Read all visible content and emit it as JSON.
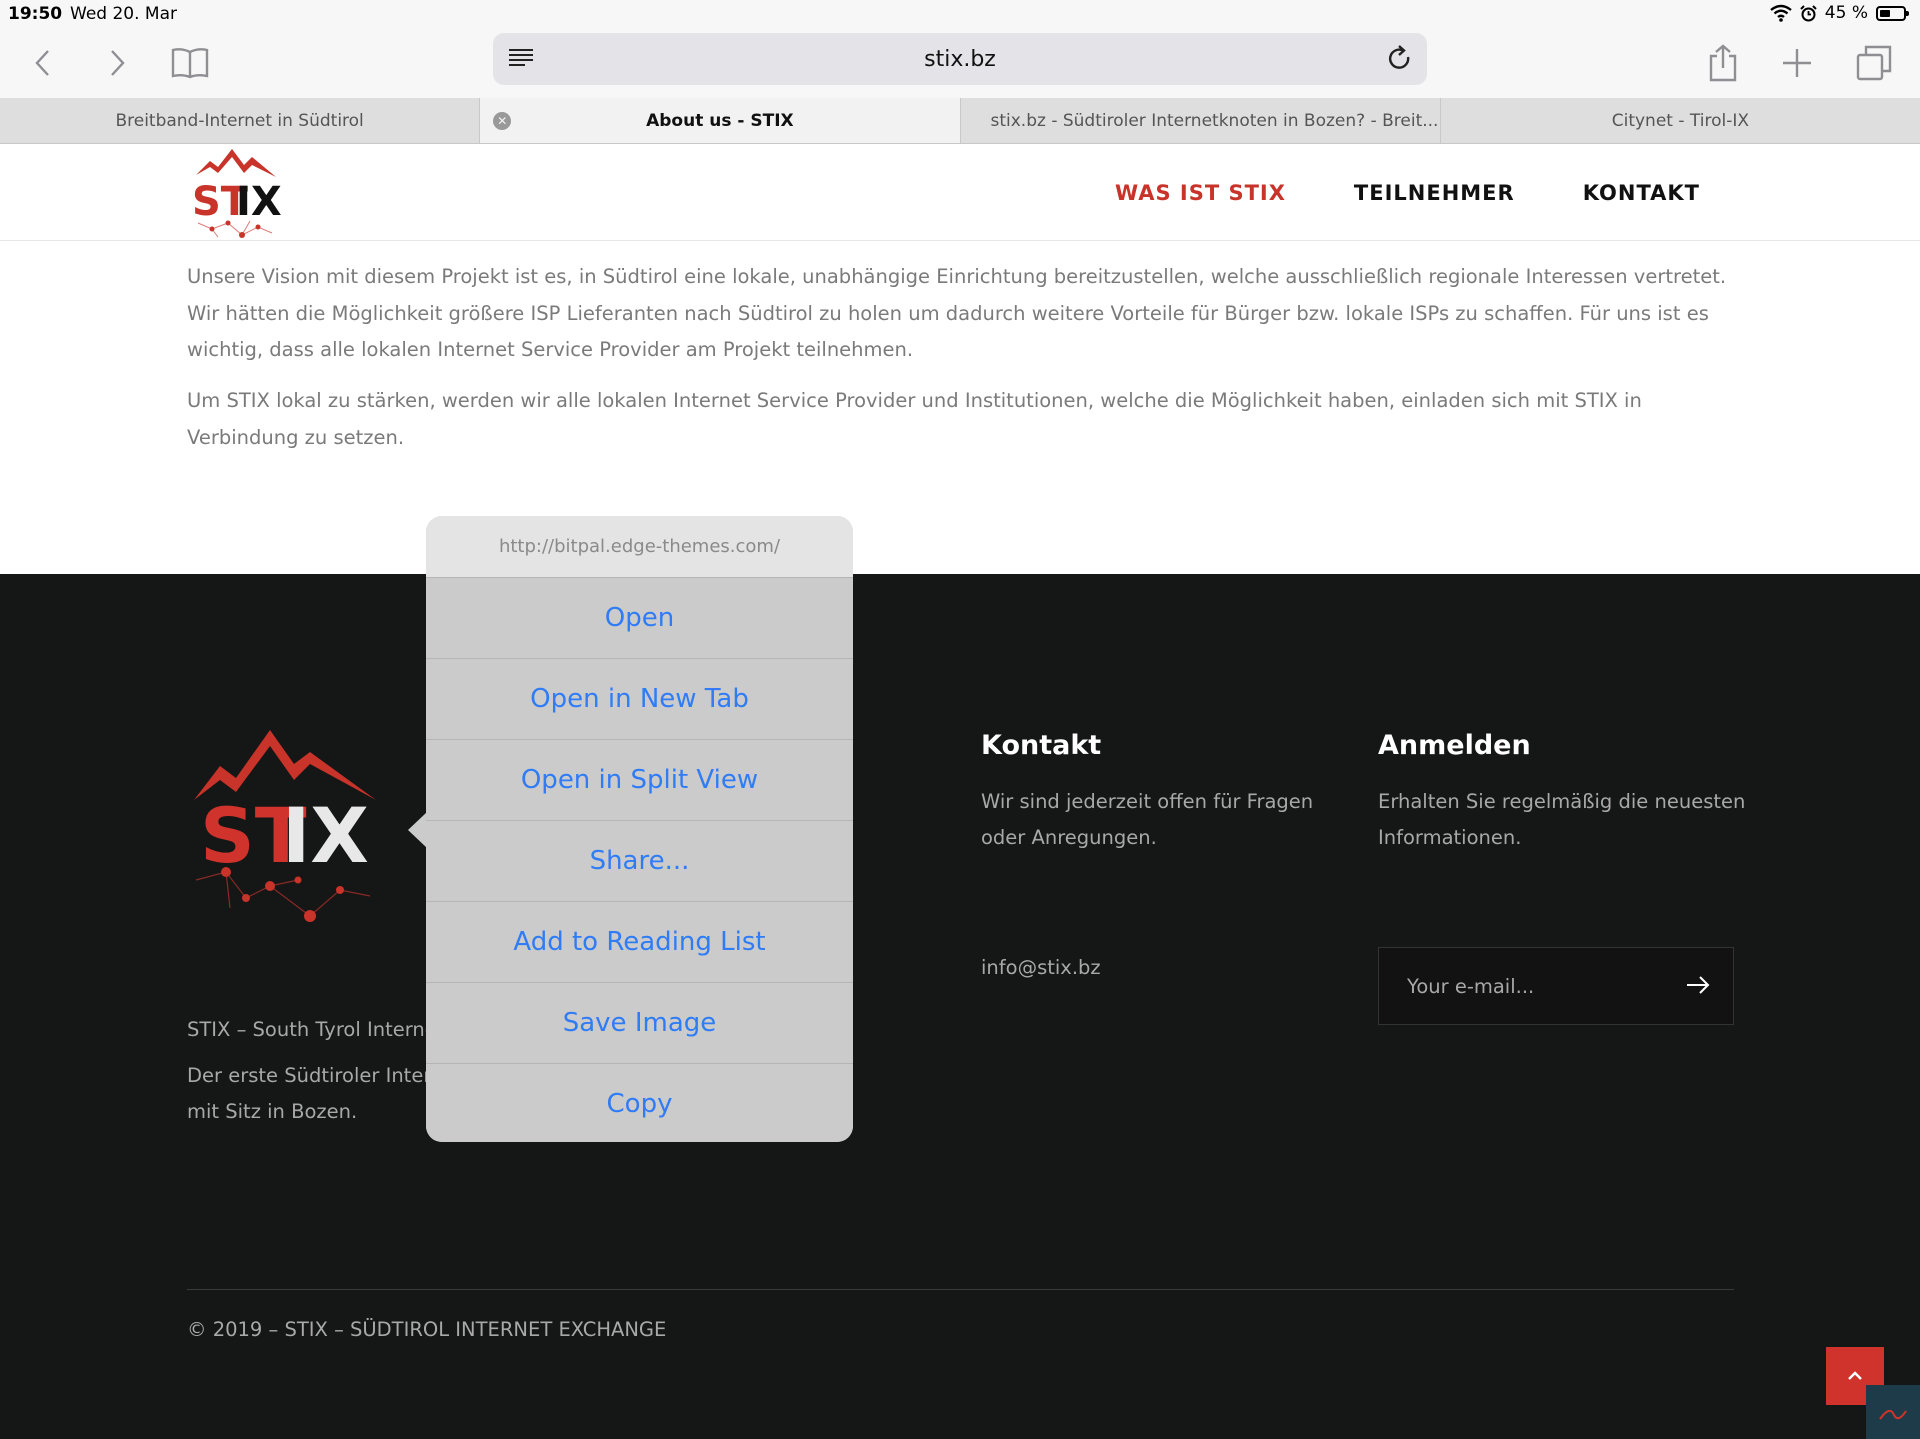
{
  "status_bar": {
    "time": "19:50",
    "date": "Wed 20. Mar",
    "battery": "45 %"
  },
  "toolbar": {
    "host": "stix.bz"
  },
  "tabs": [
    {
      "label": "Breitband-Internet in Südtirol"
    },
    {
      "label": "About us - STIX"
    },
    {
      "label": "stix.bz - Südtiroler Internetknoten in Bozen? - Breit..."
    },
    {
      "label": "Citynet - Tirol-IX"
    }
  ],
  "site": {
    "logo": {
      "st": "ST",
      "ix": "IX"
    },
    "nav": [
      {
        "label": "WAS IST STIX"
      },
      {
        "label": "TEILNEHMER"
      },
      {
        "label": "KONTAKT"
      }
    ]
  },
  "content": {
    "paragraph1": "Unsere Vision mit diesem Projekt ist es, in Südtirol eine lokale, unabhängige Einrichtung bereitzustellen, welche ausschließlich regionale Interessen vertretet. Wir hätten die Möglichkeit größere ISP Lieferanten nach Südtirol zu holen um dadurch weitere Vorteile für Bürger bzw. lokale ISPs zu schaffen. Für uns ist es wichtig, dass alle lokalen Internet Service Provider am Projekt teilnehmen.",
    "paragraph2": "Um STIX lokal zu stärken, werden wir alle lokalen Internet Service Provider und Institutionen, welche die Möglichkeit haben, einladen sich mit STIX in Verbindung zu setzen."
  },
  "footer": {
    "about_line1": "STIX – South Tyrol Internet",
    "about_line2": "Der erste Südtiroler Intern",
    "about_line3": "mit Sitz in Bozen.",
    "contact_title": "Kontakt",
    "contact_line1": "Wir sind jederzeit offen für Fragen",
    "contact_line2": "oder Anregungen.",
    "contact_email": "info@stix.bz",
    "signup_title": "Anmelden",
    "signup_line1": "Erhalten Sie regelmäßig die neuesten",
    "signup_line2": "Informationen.",
    "email_placeholder": "Your e-mail...",
    "copyright": "© 2019 – STIX – SÜDTIROL INTERNET EXCHANGE"
  },
  "context_menu": {
    "url": "http://bitpal.edge-themes.com/",
    "items": [
      {
        "label": "Open"
      },
      {
        "label": "Open in New Tab"
      },
      {
        "label": "Open in Split View"
      },
      {
        "label": "Share..."
      },
      {
        "label": "Add to Reading List"
      },
      {
        "label": "Save Image"
      },
      {
        "label": "Copy"
      }
    ]
  },
  "colors": {
    "brand_red": "#c8332a",
    "ios_blue": "#2f7cf6",
    "footer_bg": "#151616"
  }
}
